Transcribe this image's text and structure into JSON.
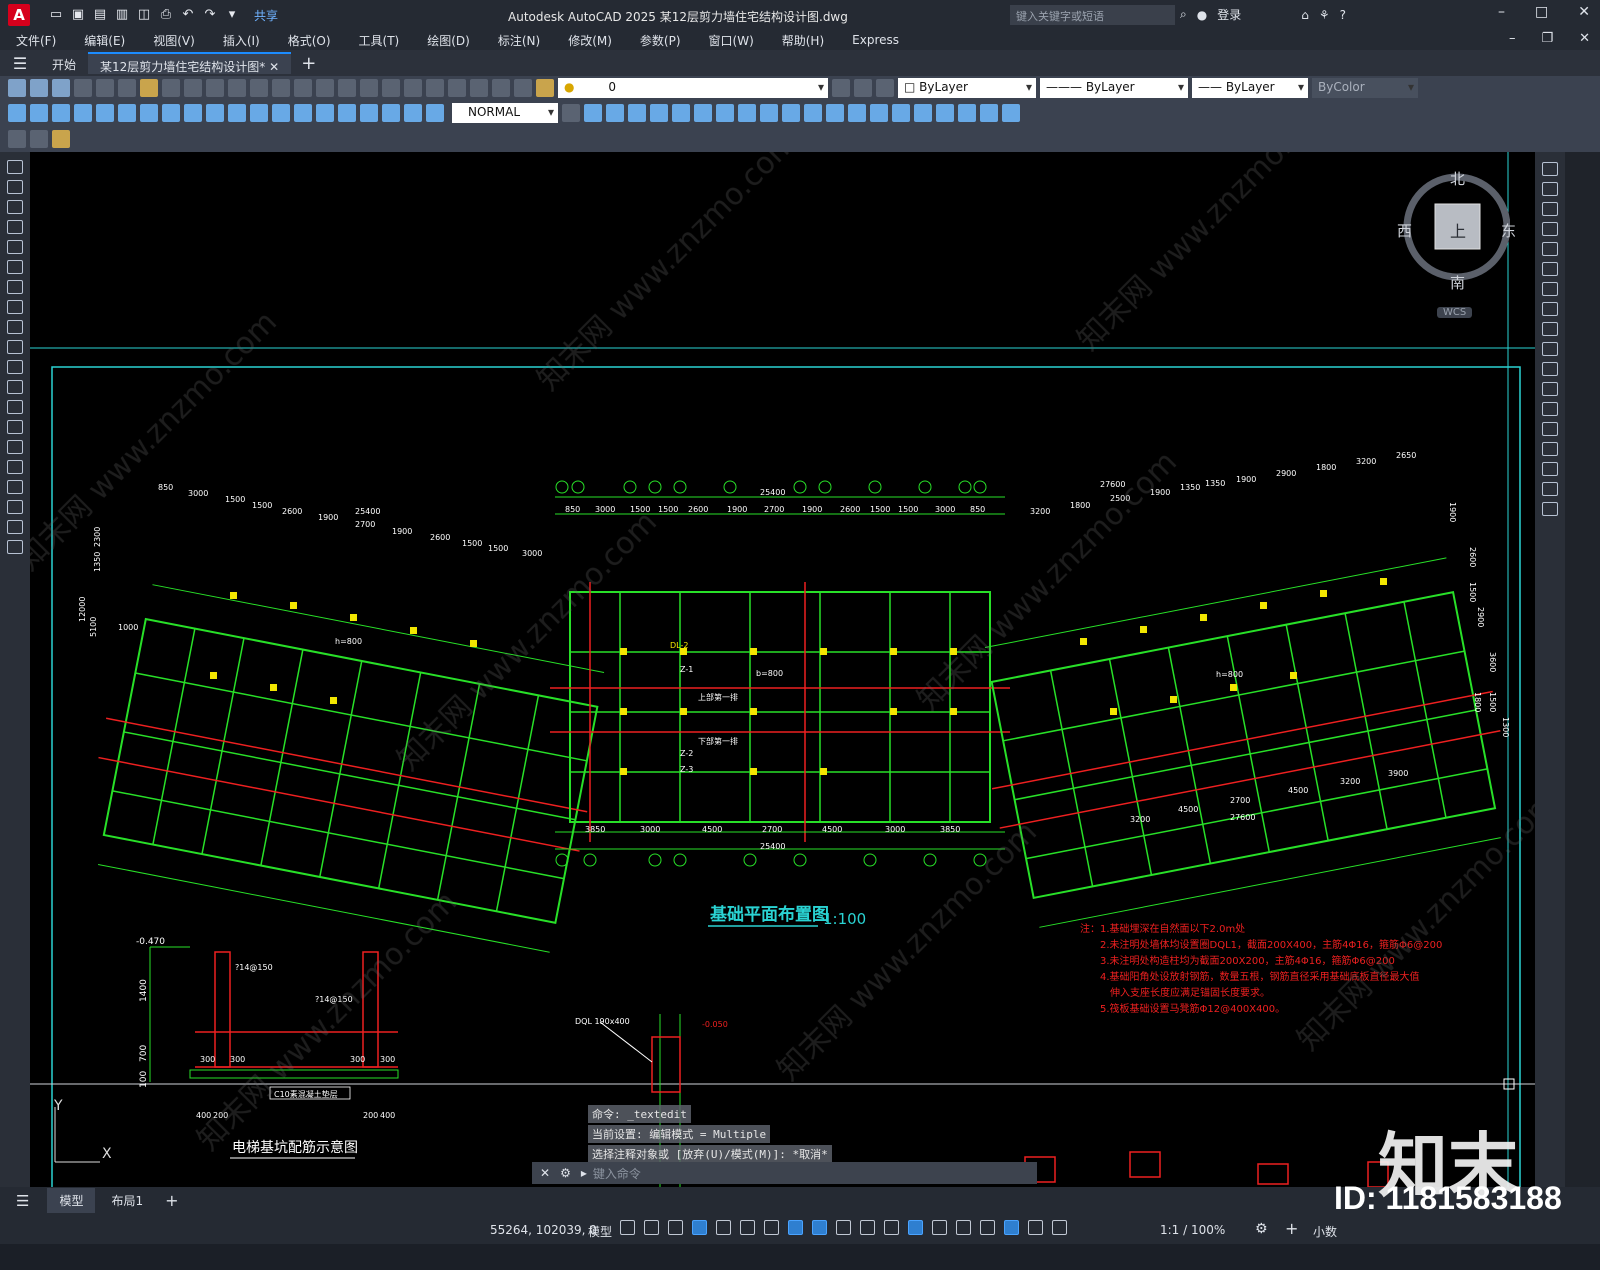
{
  "app": {
    "logo": "A",
    "title": "Autodesk AutoCAD 2025    某12层剪力墙住宅结构设计图.dwg",
    "share": "共享",
    "search_placeholder": "键入关键字或短语",
    "login": "登录"
  },
  "menu": [
    "文件(F)",
    "编辑(E)",
    "视图(V)",
    "插入(I)",
    "格式(O)",
    "工具(T)",
    "绘图(D)",
    "标注(N)",
    "修改(M)",
    "参数(P)",
    "窗口(W)",
    "帮助(H)",
    "Express"
  ],
  "tabs": [
    {
      "label": "开始"
    },
    {
      "label": "某12层剪力墙住宅结构设计图*"
    }
  ],
  "toolbar": {
    "layer_value": "0",
    "color": "ByLayer",
    "linetype": "ByLayer",
    "lineweight": "ByLayer",
    "plotstyle": "ByColor",
    "dimstyle": "NORMAL"
  },
  "viewcube": {
    "north": "北",
    "south": "南",
    "east": "东",
    "west": "西",
    "top": "上",
    "wcs": "WCS"
  },
  "drawing": {
    "main_title": "基础平面布置图",
    "scale": "1:100",
    "elevator_title": "电梯基坑配筋示意图",
    "elev_level": "-0.470",
    "elev_rebar1": "?14@150",
    "elev_rebar2": "?14@150",
    "elev_dim_1400": "1400",
    "elev_dim_700": "700",
    "elev_dim_100": "100",
    "elev_bottom": "C10素混凝土垫层",
    "elev_dims_bottom": [
      "400",
      "200",
      "200",
      "400"
    ],
    "elev_300": [
      "300",
      "300",
      "300",
      "300"
    ],
    "dql_label": "DQL 190x400",
    "dql_level": "-0.050",
    "notes": [
      "注：1.基础埋深在自然面以下2.0m处",
      "2.未注明处墙体均设置圈DQL1，截面200X400，主筋4Φ16，箍筋Φ6@200",
      "3.未注明处构造柱均为截面200X200，主筋4Φ16，箍筋Φ6@200",
      "4.基础阳角处设放射钢筋，数量五根，钢筋直径采用基础底板直径最大值",
      "伸入支座长度应满足锚固长度要求。",
      "5.筏板基础设置马凳筋Φ12@400X400。"
    ],
    "top_dims_center": [
      "850",
      "3000",
      "1500",
      "1500",
      "2600",
      "1900",
      "2700",
      "1900",
      "2600",
      "1500",
      "1500",
      "3000",
      "850"
    ],
    "top_total_center": "25400",
    "bottom_dims_center": [
      "3850",
      "3000",
      "4500",
      "2700",
      "4500",
      "3000",
      "3850"
    ],
    "bottom_total_center": "25400",
    "labels_center": [
      "DL-2",
      "b=800",
      "上部第一排",
      "下部第一排",
      "Z-1",
      "Z-2",
      "Z-3"
    ],
    "h800": "h=800",
    "top_left_dims": [
      "850",
      "3000",
      "1500",
      "1500",
      "2600",
      "1900",
      "2700",
      "1900",
      "2600",
      "1500",
      "1500",
      "3000"
    ],
    "top_left_total": "25400",
    "top_right_dims": [
      "3200",
      "1800",
      "2500",
      "1900",
      "1350",
      "1350",
      "1900",
      "2900",
      "1800",
      "3200",
      "2650"
    ],
    "top_right_total": "27600",
    "left_side_dims": [
      "2300",
      "1350",
      "12000",
      "5100",
      "1000"
    ],
    "right_side_dims": [
      "1900",
      "2600",
      "1500",
      "2900",
      "3600",
      "1800",
      "1500",
      "1300"
    ],
    "bottom_right_dims": [
      "3200",
      "4500",
      "2700",
      "4500",
      "3200",
      "3900"
    ],
    "bottom_right_total": "27600"
  },
  "command": {
    "history": [
      "命令: _textedit",
      "当前设置: 编辑模式 = Multiple",
      "选择注释对象或 [放弃(U)/模式(M)]: *取消*"
    ],
    "placeholder": "键入命令"
  },
  "layout_tabs": [
    "模型",
    "布局1"
  ],
  "status": {
    "coords": "55264, 102039, 0",
    "mode": "模型",
    "scale": "1:1 / 100%",
    "units": "小数"
  },
  "watermark": {
    "id": "ID: 1181583188",
    "brand": "知末"
  }
}
